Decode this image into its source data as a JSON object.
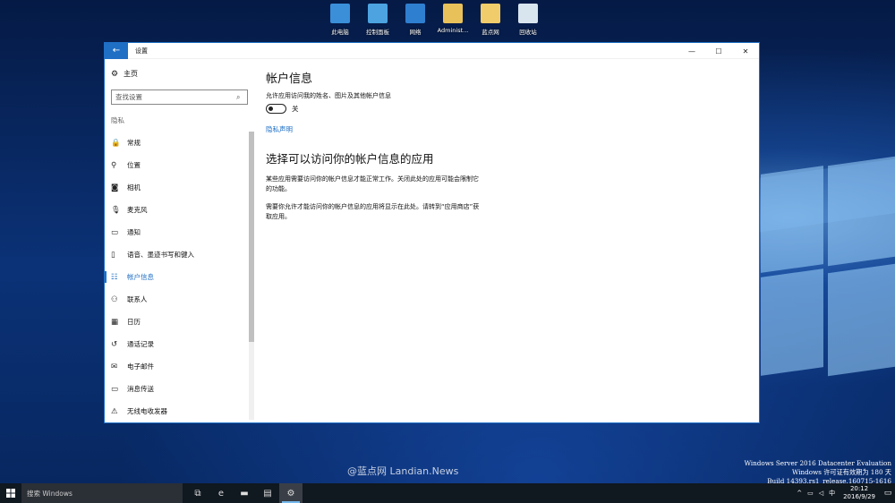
{
  "desktop": {
    "icons": [
      {
        "label": "此电脑",
        "icon": "computer-icon",
        "color": "#3a8fd8"
      },
      {
        "label": "控制面板",
        "icon": "control-panel-icon",
        "color": "#4ca3e0"
      },
      {
        "label": "网络",
        "icon": "network-icon",
        "color": "#2f7fd0"
      },
      {
        "label": "Administ...",
        "icon": "user-folder-icon",
        "color": "#e8c15a"
      },
      {
        "label": "蓝点网",
        "icon": "folder-icon",
        "color": "#f0cc6a"
      },
      {
        "label": "回收站",
        "icon": "recycle-bin-icon",
        "color": "#d8e4ee"
      }
    ]
  },
  "window": {
    "title": "设置",
    "back_icon": "←",
    "controls": {
      "minimize": "—",
      "maximize": "☐",
      "close": "✕"
    }
  },
  "sidebar": {
    "home_label": "主页",
    "search_placeholder": "查找设置",
    "section_title": "隐私",
    "items": [
      {
        "label": "常规",
        "icon": "lock-icon",
        "glyph": "🔒"
      },
      {
        "label": "位置",
        "icon": "location-icon",
        "glyph": "⚲"
      },
      {
        "label": "相机",
        "icon": "camera-icon",
        "glyph": "◙"
      },
      {
        "label": "麦克风",
        "icon": "microphone-icon",
        "glyph": "🎙"
      },
      {
        "label": "通知",
        "icon": "notification-icon",
        "glyph": "▭"
      },
      {
        "label": "语音、墨迹书写和键入",
        "icon": "speech-icon",
        "glyph": "▯"
      },
      {
        "label": "帐户信息",
        "icon": "account-info-icon",
        "glyph": "☷"
      },
      {
        "label": "联系人",
        "icon": "contacts-icon",
        "glyph": "⚇"
      },
      {
        "label": "日历",
        "icon": "calendar-icon",
        "glyph": "▦"
      },
      {
        "label": "通话记录",
        "icon": "call-history-icon",
        "glyph": "↺"
      },
      {
        "label": "电子邮件",
        "icon": "email-icon",
        "glyph": "✉"
      },
      {
        "label": "消息传送",
        "icon": "messaging-icon",
        "glyph": "▭"
      },
      {
        "label": "无线电收发器",
        "icon": "radio-icon",
        "glyph": "⚠"
      }
    ],
    "active_index": 6
  },
  "content": {
    "heading": "帐户信息",
    "allow_label": "允许应用访问我的姓名、图片及其他帐户信息",
    "toggle_state_label": "关",
    "privacy_link": "隐私声明",
    "subheading": "选择可以访问你的帐户信息的应用",
    "paragraph1": "某些应用需要访问你的帐户信息才能正常工作。关闭此处的应用可能会限制它的功能。",
    "paragraph2": "需要你允许才能访问你的帐户信息的应用将显示在此处。请转到“应用商店”获取应用。"
  },
  "watermark": "@蓝点网 Landian.News",
  "sysinfo": [
    "Windows Server 2016 Datacenter Evaluation",
    "Windows 许可证有效期为 180 天",
    "Build 14393.rs1_release.160715-1616"
  ],
  "taskbar": {
    "search_placeholder": "搜索 Windows",
    "apps": [
      {
        "icon": "task-view-icon",
        "glyph": "⧉"
      },
      {
        "icon": "edge-icon",
        "glyph": "e"
      },
      {
        "icon": "file-explorer-icon",
        "glyph": "▬"
      },
      {
        "icon": "server-manager-icon",
        "glyph": "▤"
      },
      {
        "icon": "settings-icon",
        "glyph": "⚙"
      }
    ],
    "tray": {
      "chevron": "^",
      "network": "▭",
      "volume": "◁",
      "ime": "中",
      "time": "20:12",
      "date": "2016/9/29"
    }
  }
}
